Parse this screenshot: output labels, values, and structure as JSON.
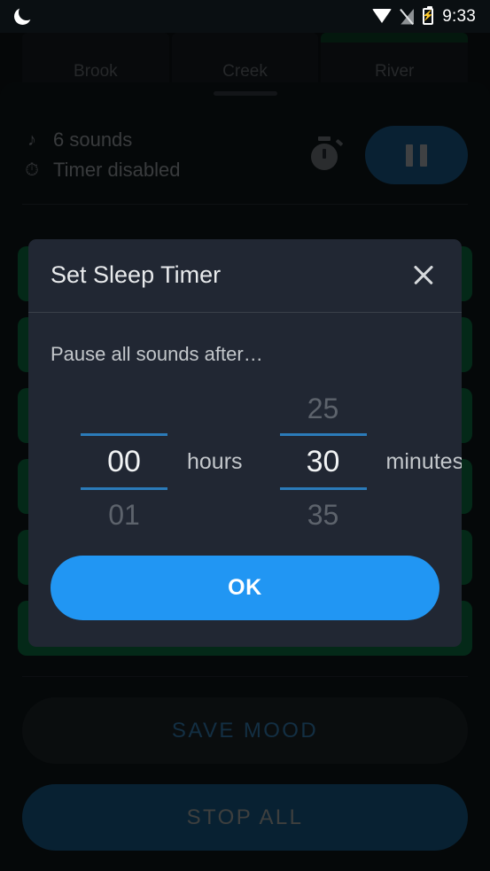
{
  "status_bar": {
    "moon_icon": "moon-icon",
    "wifi_icon": "wifi-icon",
    "signal_off_icon": "signal-off-icon",
    "battery_icon": "battery-charging-icon",
    "time": "9:33"
  },
  "tabs": [
    {
      "label": "Brook",
      "active": false
    },
    {
      "label": "Creek",
      "active": false
    },
    {
      "label": "River",
      "active": true
    }
  ],
  "player_header": {
    "sounds_icon": "music-note-icon",
    "sounds_text": "6 sounds",
    "timer_status_icon": "stopwatch-icon",
    "timer_status_text": "Timer disabled",
    "timer_button_icon": "stopwatch-icon",
    "pause_button_icon": "pause-icon"
  },
  "dialog": {
    "title": "Set Sleep Timer",
    "close_icon": "close-icon",
    "subtitle": "Pause all sounds after…",
    "hours_picker": {
      "above": "",
      "value": "00",
      "below": "01",
      "unit": "hours"
    },
    "minutes_picker": {
      "above": "25",
      "value": "30",
      "below": "35",
      "unit": "minutes"
    },
    "ok_label": "OK"
  },
  "bottom_actions": {
    "save_mood_label": "SAVE MOOD",
    "stop_all_label": "STOP ALL"
  },
  "colors": {
    "accent_blue": "#2196f3",
    "picker_line": "#2b7bb9",
    "sound_row_green": "#0b5c36",
    "dialog_bg": "#212733",
    "pause_button": "#154a72",
    "stop_all_bg": "#134a70"
  }
}
